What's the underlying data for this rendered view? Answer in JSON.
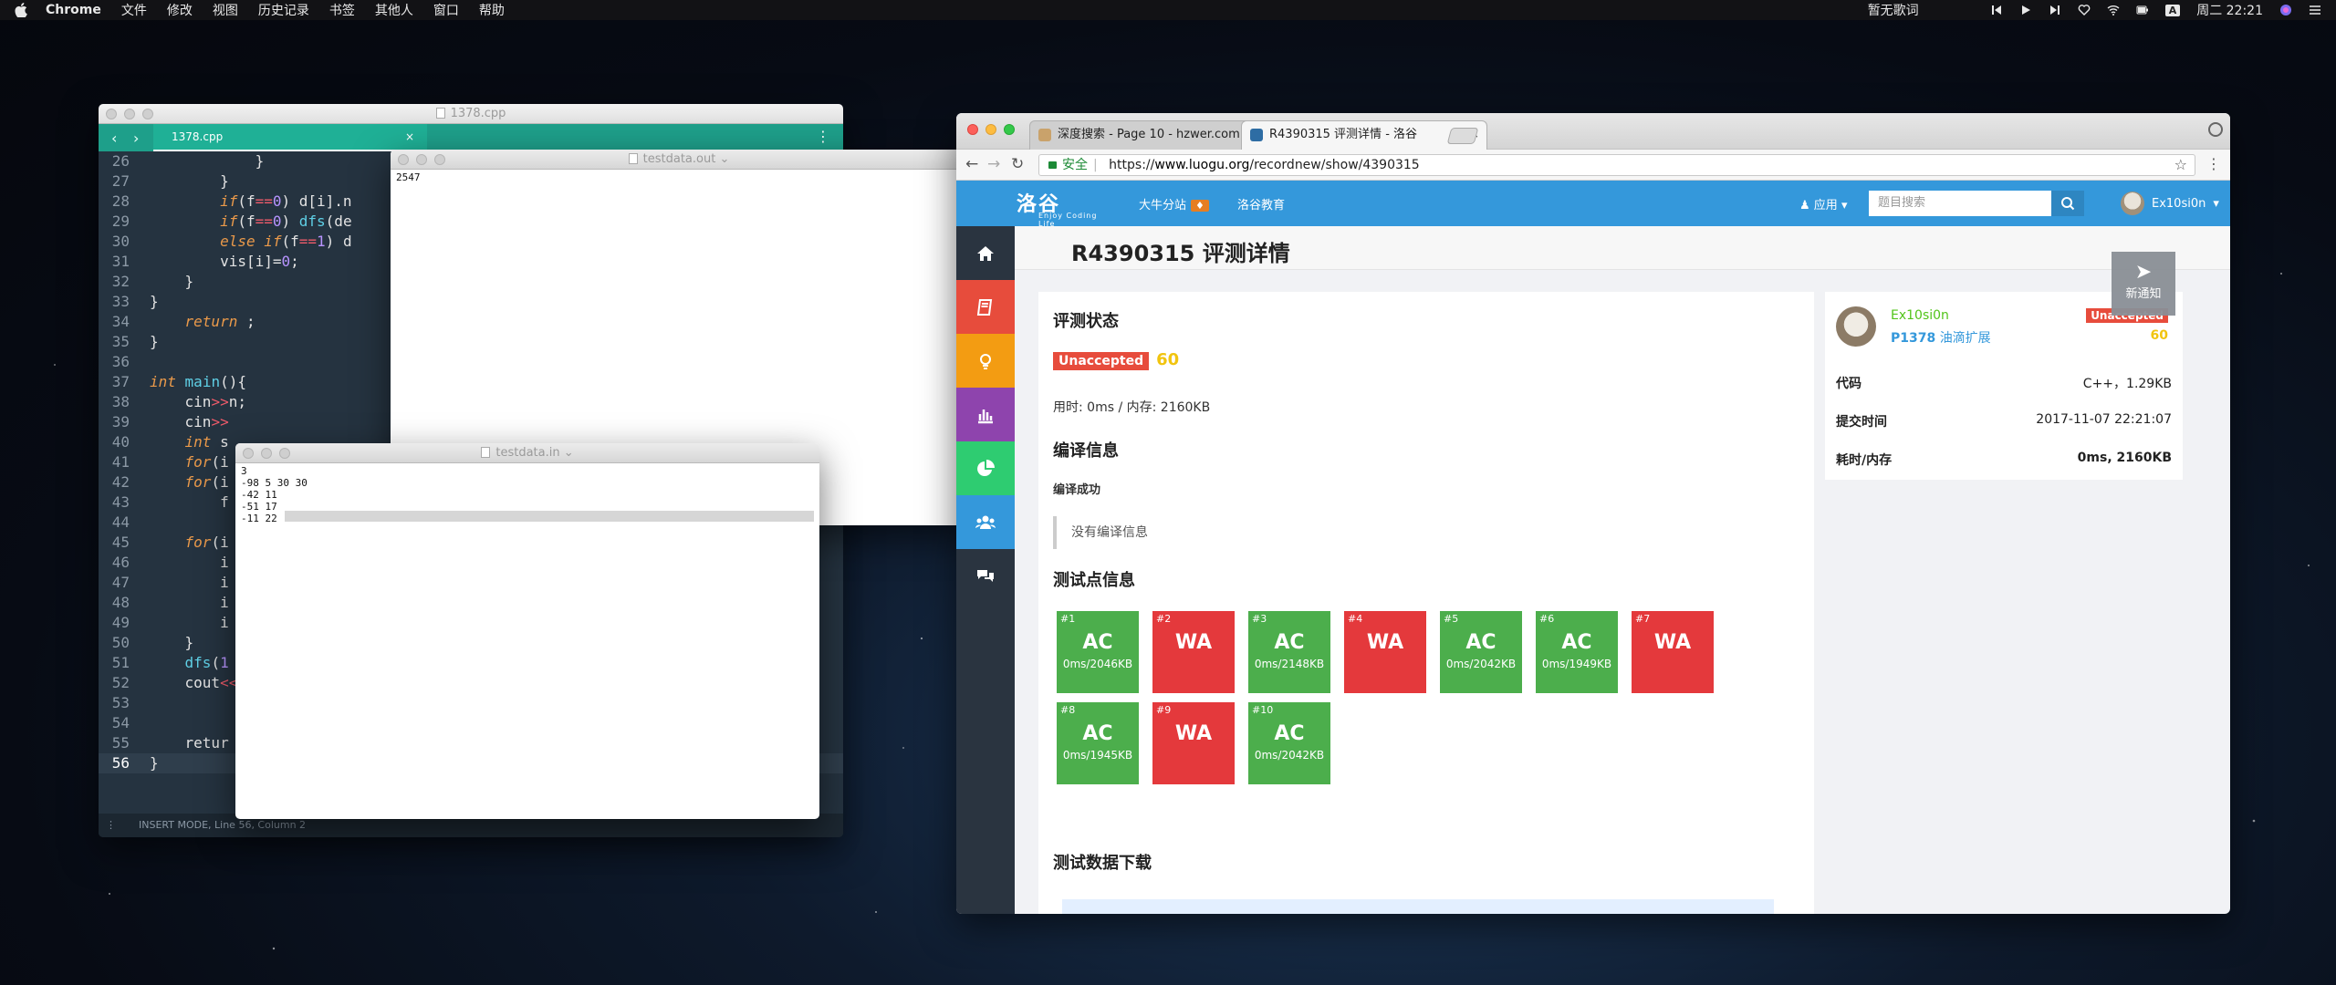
{
  "menubar": {
    "app": "Chrome",
    "items": [
      "文件",
      "修改",
      "视图",
      "历史记录",
      "书签",
      "其他人",
      "窗口",
      "帮助"
    ],
    "lyrics": "暂无歌词",
    "input_method": "A",
    "clock": "周二 22:21"
  },
  "editor": {
    "title": "1378.cpp",
    "tab": "1378.cpp",
    "status": "INSERT MODE, Line 56, Column 2",
    "lines": [
      {
        "n": "26",
        "code": "            }"
      },
      {
        "n": "27",
        "code": "        }"
      },
      {
        "n": "28",
        "code": "        if(f==0) d[i].n"
      },
      {
        "n": "29",
        "code": "        if(f==0) dfs(de"
      },
      {
        "n": "30",
        "code": "        else if(f==1) d"
      },
      {
        "n": "31",
        "code": "        vis[i]=0;"
      },
      {
        "n": "32",
        "code": "    }"
      },
      {
        "n": "33",
        "code": "}"
      },
      {
        "n": "34",
        "code": "    return ;"
      },
      {
        "n": "35",
        "code": "}"
      },
      {
        "n": "36",
        "code": ""
      },
      {
        "n": "37",
        "code": "int main(){"
      },
      {
        "n": "38",
        "code": "    cin>>n;"
      },
      {
        "n": "39",
        "code": "    cin>>"
      },
      {
        "n": "40",
        "code": "    int s"
      },
      {
        "n": "41",
        "code": "    for(i"
      },
      {
        "n": "42",
        "code": "    for(i"
      },
      {
        "n": "43",
        "code": "        f"
      },
      {
        "n": "44",
        "code": ""
      },
      {
        "n": "45",
        "code": "    for(i"
      },
      {
        "n": "46",
        "code": "        i"
      },
      {
        "n": "47",
        "code": "        i"
      },
      {
        "n": "48",
        "code": "        i"
      },
      {
        "n": "49",
        "code": "        i"
      },
      {
        "n": "50",
        "code": "    }"
      },
      {
        "n": "51",
        "code": "    dfs(1"
      },
      {
        "n": "52",
        "code": "    cout<<"
      },
      {
        "n": "53",
        "code": ""
      },
      {
        "n": "54",
        "code": ""
      },
      {
        "n": "55",
        "code": "    retur"
      },
      {
        "n": "56",
        "code": "}"
      }
    ]
  },
  "outwin": {
    "title": "testdata.out",
    "content": "2547"
  },
  "inwin": {
    "title": "testdata.in",
    "content": "3\n-98 5 30 30\n-42 11\n-51 17\n-11 22"
  },
  "browser": {
    "tabs": [
      {
        "label": "深度搜索 - Page 10 - hzwer.com"
      },
      {
        "label": "R4390315 评测详情 - 洛谷"
      }
    ],
    "secure_label": "安全",
    "url_scheme": "https://",
    "url_host": "www.luogu.org",
    "url_path": "/recordnew/show/4390315"
  },
  "luogu": {
    "logo": "洛谷",
    "logo_sub": "Enjoy Coding Life",
    "nav_links": [
      "大牛分站",
      "洛谷教育"
    ],
    "apps": "应用",
    "search_placeholder": "题目搜索",
    "username": "Ex10si0n",
    "page_title": "R4390315 评测详情",
    "notify_label": "新通知",
    "status_heading": "评测状态",
    "status_tag": "Unaccepted",
    "score": "60",
    "usage": "用时: 0ms / 内存: 2160KB",
    "compile_heading": "编译信息",
    "compile_ok": "编译成功",
    "compile_msg": "没有编译信息",
    "tests_heading": "测试点信息",
    "download_heading": "测试数据下载",
    "testcases": [
      {
        "id": "#1",
        "result": "AC",
        "detail": "0ms/2046KB"
      },
      {
        "id": "#2",
        "result": "WA",
        "detail": ""
      },
      {
        "id": "#3",
        "result": "AC",
        "detail": "0ms/2148KB"
      },
      {
        "id": "#4",
        "result": "WA",
        "detail": ""
      },
      {
        "id": "#5",
        "result": "AC",
        "detail": "0ms/2042KB"
      },
      {
        "id": "#6",
        "result": "AC",
        "detail": "0ms/1949KB"
      },
      {
        "id": "#7",
        "result": "WA",
        "detail": ""
      },
      {
        "id": "#8",
        "result": "AC",
        "detail": "0ms/1945KB"
      },
      {
        "id": "#9",
        "result": "WA",
        "detail": ""
      },
      {
        "id": "#10",
        "result": "AC",
        "detail": "0ms/2042KB"
      }
    ],
    "info": {
      "user": "Ex10si0n",
      "status_tag": "Unaccepted",
      "problem_id": "P1378",
      "problem_name": "油滴扩展",
      "score": "60",
      "rows": [
        {
          "k": "代码",
          "v": "C++，1.29KB"
        },
        {
          "k": "提交时间",
          "v": "2017-11-07 22:21:07"
        },
        {
          "k": "耗时/内存",
          "v": "0ms, 2160KB"
        }
      ]
    }
  },
  "colors": {
    "ac": "#4cae4c",
    "wa": "#e4393c",
    "luogu_blue": "#3498db",
    "side_colors": [
      "#2a3440",
      "#e74c3c",
      "#f39c12",
      "#8e44ad",
      "#2ecc71",
      "#3498db",
      "#2a3440"
    ]
  }
}
